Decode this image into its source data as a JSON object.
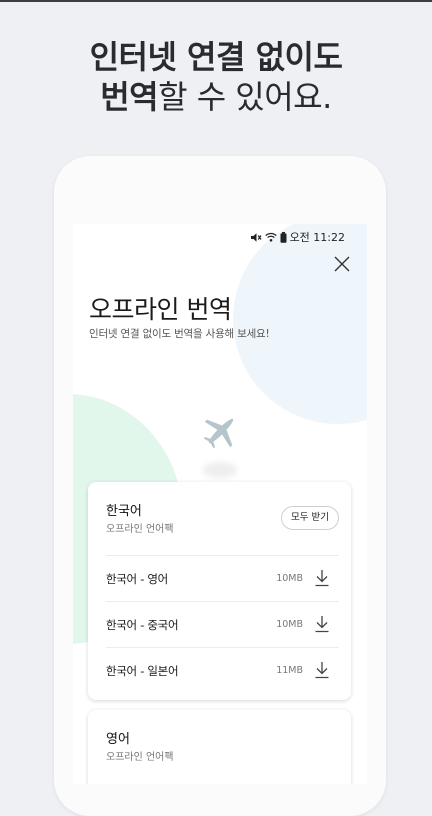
{
  "promo": {
    "line1": "인터넷 연결 없이도",
    "line2_bold": "번역",
    "line2_rest": "할 수 있어요."
  },
  "status_bar": {
    "icons": [
      "mute-icon",
      "wifi-icon",
      "battery-icon"
    ],
    "time": "오전 11:22"
  },
  "screen": {
    "title": "오프라인 번역",
    "subtitle": "인터넷 연결 없이도 번역을 사용해 보세요!"
  },
  "packs": [
    {
      "language": "한국어",
      "caption": "오프라인 언어팩",
      "download_all_label": "모두 받기",
      "items": [
        {
          "label": "한국어 - 영어",
          "size": "10MB"
        },
        {
          "label": "한국어 - 중국어",
          "size": "10MB"
        },
        {
          "label": "한국어 - 일본어",
          "size": "11MB"
        }
      ]
    },
    {
      "language": "영어",
      "caption": "오프라인 언어팩"
    }
  ],
  "colors": {
    "background": "#eef0f4",
    "blob_blue": "#eef6fb",
    "blob_green": "#e2f7ec",
    "plane": "#b6c4cc"
  }
}
